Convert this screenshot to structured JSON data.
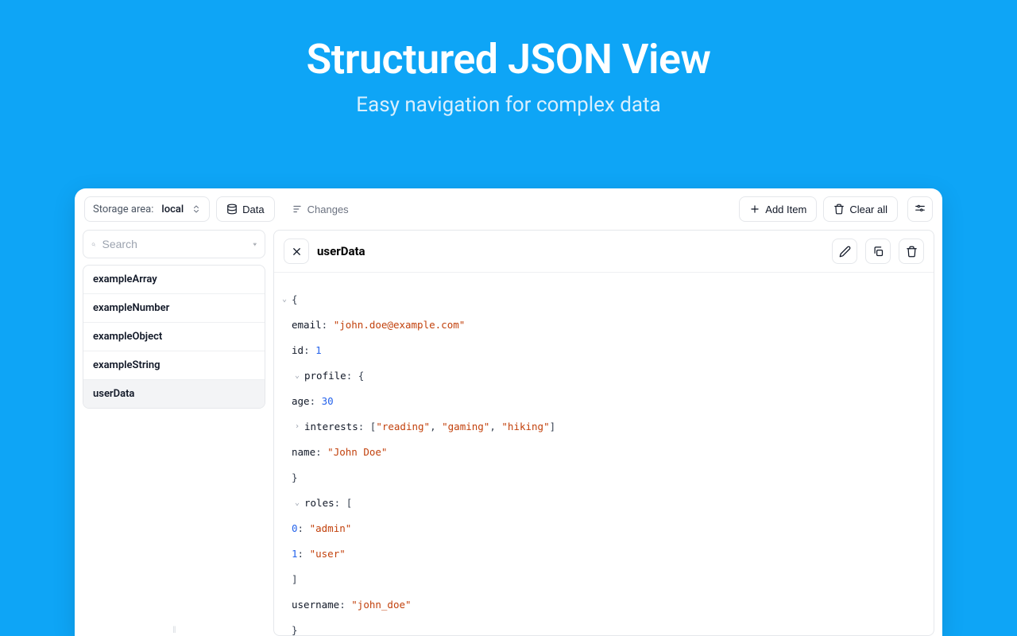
{
  "hero": {
    "title": "Structured JSON View",
    "subtitle": "Easy navigation for complex data"
  },
  "toolbar": {
    "storage_label": "Storage area:",
    "storage_value": "local",
    "tab_data": "Data",
    "tab_changes": "Changes",
    "add_item": "Add Item",
    "clear_all": "Clear all"
  },
  "search": {
    "placeholder": "Search"
  },
  "keys": [
    "exampleArray",
    "exampleNumber",
    "exampleObject",
    "exampleString",
    "userData"
  ],
  "selected_key": "userData",
  "detail": {
    "title": "userData"
  },
  "json": {
    "email_key": "email",
    "email_val": "\"john.doe@example.com\"",
    "id_key": "id",
    "id_val": "1",
    "profile_key": "profile",
    "age_key": "age",
    "age_val": "30",
    "interests_key": "interests",
    "interests_vals": [
      "\"reading\"",
      "\"gaming\"",
      "\"hiking\""
    ],
    "name_key": "name",
    "name_val": "\"John Doe\"",
    "roles_key": "roles",
    "roles": [
      {
        "idx": "0",
        "val": "\"admin\""
      },
      {
        "idx": "1",
        "val": "\"user\""
      }
    ],
    "username_key": "username",
    "username_val": "\"john_doe\""
  }
}
